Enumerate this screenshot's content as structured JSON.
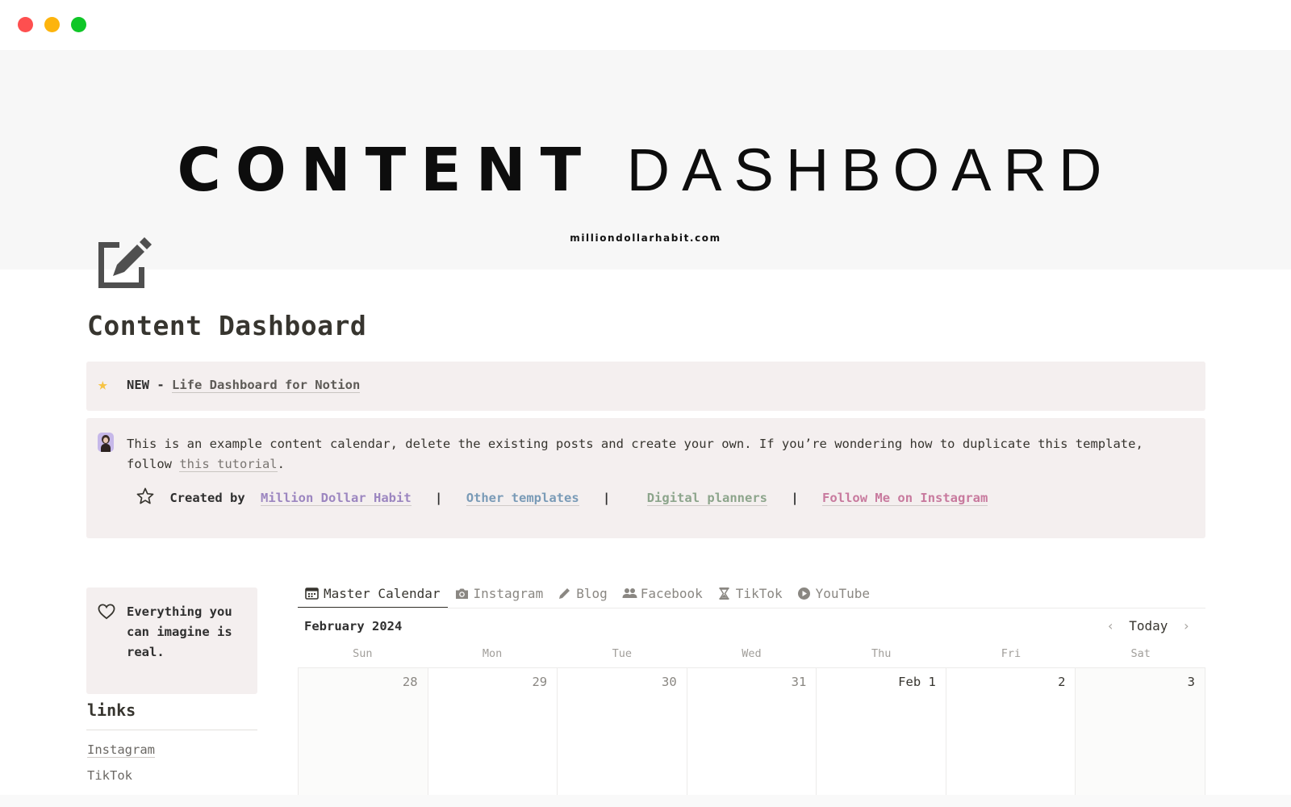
{
  "window": {
    "controls": [
      "close",
      "minimize",
      "maximize"
    ]
  },
  "cover": {
    "title_bold": "CONTENT",
    "title_light": "DASHBOARD",
    "subtitle": "milliondollarhabit.com"
  },
  "page": {
    "icon": "edit-square-icon",
    "title": "Content Dashboard"
  },
  "callout_new": {
    "icon": "star-emoji",
    "prefix": "NEW - ",
    "link": "Life Dashboard for Notion"
  },
  "callout_info": {
    "icon": "avatar",
    "text_before": "This is an example content calendar, delete the existing posts and create your own. If you’re wondering how to duplicate this template, follow ",
    "link": "this tutorial",
    "text_after": ".",
    "credits": {
      "icon": "star-outline-icon",
      "label": "Created by",
      "links": [
        {
          "label": "Million Dollar Habit",
          "color": "#9c86c0"
        },
        {
          "label": "Other templates",
          "color": "#7a9bb7"
        },
        {
          "label": "Digital planners",
          "color": "#8da58c"
        },
        {
          "label": "Follow Me on Instagram",
          "color": "#c87a9e"
        }
      ],
      "separator": "|"
    }
  },
  "sidebar": {
    "quote_icon": "heart-icon",
    "quote": "Everything you can imagine is real.",
    "links_title": "links",
    "links": [
      "Instagram",
      "TikTok"
    ]
  },
  "tabs": [
    {
      "label": "Master Calendar",
      "icon": "calendar-icon",
      "active": true
    },
    {
      "label": "Instagram",
      "icon": "camera-icon",
      "active": false
    },
    {
      "label": "Blog",
      "icon": "pencil-icon",
      "active": false
    },
    {
      "label": "Facebook",
      "icon": "people-icon",
      "active": false
    },
    {
      "label": "TikTok",
      "icon": "hourglass-icon",
      "active": false
    },
    {
      "label": "YouTube",
      "icon": "play-circle-icon",
      "active": false
    }
  ],
  "calendar": {
    "month": "February 2024",
    "prev_label": "‹",
    "today_label": "Today",
    "next_label": "›",
    "weekdays": [
      "Sun",
      "Mon",
      "Tue",
      "Wed",
      "Thu",
      "Fri",
      "Sat"
    ],
    "days": [
      "28",
      "29",
      "30",
      "31",
      "Feb 1",
      "2",
      "3"
    ]
  }
}
